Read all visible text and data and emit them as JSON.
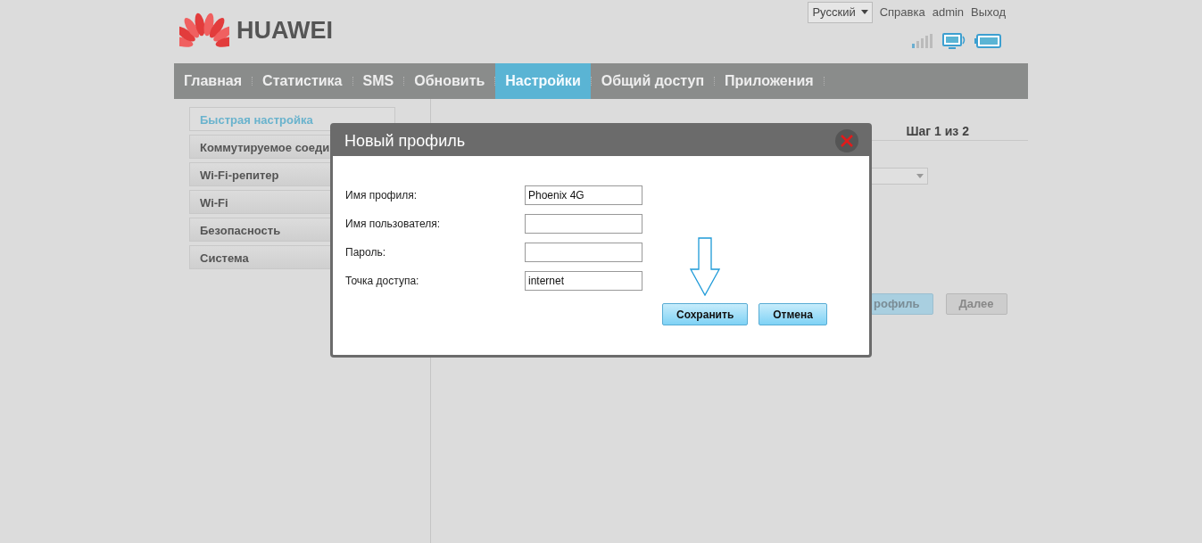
{
  "header": {
    "logo_text": "HUAWEI",
    "language": "Русский",
    "links": [
      "Справка",
      "admin",
      "Выход"
    ]
  },
  "nav": [
    {
      "label": "Главная",
      "selected": false
    },
    {
      "label": "Статистика",
      "selected": false
    },
    {
      "label": "SMS",
      "selected": false
    },
    {
      "label": "Обновить",
      "selected": false
    },
    {
      "label": "Настройки",
      "selected": true
    },
    {
      "label": "Общий доступ",
      "selected": false
    },
    {
      "label": "Приложения",
      "selected": false
    }
  ],
  "sidebar": [
    {
      "label": "Быстрая настройка",
      "selected": true
    },
    {
      "label": "Коммутируемое соеди",
      "selected": false
    },
    {
      "label": "Wi-Fi-репитер",
      "selected": false
    },
    {
      "label": "Wi-Fi",
      "selected": false
    },
    {
      "label": "Безопасность",
      "selected": false
    },
    {
      "label": "Система",
      "selected": false
    }
  ],
  "content": {
    "step": "Шаг 1 из 2",
    "buttons": [
      {
        "label": "рофиль",
        "kind": "primary"
      },
      {
        "label": "Далее",
        "kind": "secondary"
      }
    ]
  },
  "dialog": {
    "title": "Новый профиль",
    "fields": [
      {
        "label": "Имя профиля:",
        "value": "Phoenix 4G"
      },
      {
        "label": "Имя пользователя:"
      },
      {
        "label": "Пароль:"
      },
      {
        "label": "Точка доступа:",
        "value": "internet"
      }
    ],
    "buttons": [
      "Сохранить",
      "Отмена"
    ]
  }
}
